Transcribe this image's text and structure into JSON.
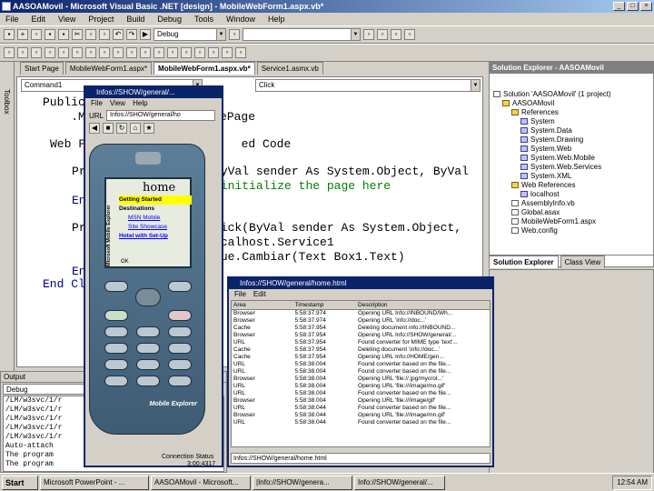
{
  "window": {
    "title": "AASOAMovil - Microsoft Visual Basic .NET [design] - MobileWebForm1.aspx.vb*"
  },
  "menu": [
    "File",
    "Edit",
    "View",
    "Project",
    "Build",
    "Debug",
    "Tools",
    "Window",
    "Help"
  ],
  "toolbar": {
    "config": "Debug"
  },
  "code_toolbar": {
    "object": "Command1",
    "event": "Click"
  },
  "tabs": [
    "Start Page",
    "MobileWebForm1.aspx*",
    "MobileWebForm1.aspx.vb*",
    "Service1.asmx.vb"
  ],
  "left_toolbox_label": "Toolbox",
  "code_lines": [
    {
      "text": "Public",
      "cls": "kw"
    },
    {
      "text": "    .MobileControls.MobilePage",
      "cls": ""
    },
    {
      "text": "Web F                      ed Code",
      "cls": ""
    },
    {
      "text": "Pri                 ByVal sender As System.Object, ByVal",
      "cls": ""
    },
    {
      "text": "                     initialize the page here",
      "cls": "cm"
    },
    {
      "text": "End",
      "cls": "kw"
    },
    {
      "text": "Pri                 lick(ByVal sender As System.Object,",
      "cls": ""
    },
    {
      "text": "                   localhost.Service1",
      "cls": ""
    },
    {
      "text": "                   gmue.Cambiar(Text Box1.Text)",
      "cls": ""
    },
    {
      "text": "End",
      "cls": "kw"
    },
    {
      "text": "End Cl",
      "cls": "kw"
    }
  ],
  "output": {
    "title": "Output",
    "mode": "Debug",
    "lines": [
      "/LM/w3svc/1/r",
      "/LM/w3svc/1/r",
      "/LM/w3svc/1/r",
      "/LM/w3svc/1/r",
      "/LM/w3svc/1/r",
      "Auto-attach",
      "The program",
      "The program"
    ]
  },
  "solution_explorer": {
    "title": "Solution Explorer - AASOAMovil",
    "items": [
      {
        "label": "Solution 'AASOAMovil' (1 project)",
        "icon": "file",
        "indent": 0
      },
      {
        "label": "AASOAMovil",
        "icon": "folder",
        "indent": 1
      },
      {
        "label": "References",
        "icon": "folder",
        "indent": 2
      },
      {
        "label": "System",
        "icon": "ref",
        "indent": 3
      },
      {
        "label": "System.Data",
        "icon": "ref",
        "indent": 3
      },
      {
        "label": "System.Drawing",
        "icon": "ref",
        "indent": 3
      },
      {
        "label": "System.Web",
        "icon": "ref",
        "indent": 3
      },
      {
        "label": "System.Web.Mobile",
        "icon": "ref",
        "indent": 3
      },
      {
        "label": "System.Web.Services",
        "icon": "ref",
        "indent": 3
      },
      {
        "label": "System.XML",
        "icon": "ref",
        "indent": 3
      },
      {
        "label": "Web References",
        "icon": "folder",
        "indent": 2
      },
      {
        "label": "localhost",
        "icon": "ref",
        "indent": 3
      },
      {
        "label": "AssemblyInfo.vb",
        "icon": "file",
        "indent": 2
      },
      {
        "label": "Global.asax",
        "icon": "file",
        "indent": 2
      },
      {
        "label": "MobileWebForm1.aspx",
        "icon": "file",
        "indent": 2
      },
      {
        "label": "Web.config",
        "icon": "file",
        "indent": 2
      }
    ],
    "tabs": [
      "Solution Explorer",
      "Class View"
    ]
  },
  "emulator": {
    "title": "Infos://SHOW/general/...",
    "menu": [
      "File",
      "View",
      "Help"
    ],
    "url_label": "URL",
    "url": "Infos://SHOW/general/ho",
    "screen_title": "home",
    "side_label": "Microsoft Mobile Explorer",
    "links": [
      "Getting Started",
      "Destinations",
      "MSN Mobile",
      "Site Showcase",
      "Hotel with Set-Up"
    ],
    "softkey": "OK",
    "brand": "Mobile Explorer",
    "footer": "Connection Status",
    "footer2": "3:00:4317"
  },
  "log_window": {
    "title": "Infos://SHOW/general/home.html",
    "menu": [
      "File",
      "Edit"
    ],
    "headers": [
      "Area",
      "Timestamp",
      "Description"
    ],
    "rows": [
      [
        "Browser",
        "5:58:37.974",
        "Opening URL Info://INBOUND/Wh..."
      ],
      [
        "Browser",
        "5:58:37.974",
        "Opening URL 'info://doc...'"
      ],
      [
        "Cache",
        "5:58:37.954",
        "Deleting document info://INBOUND..."
      ],
      [
        "Browser",
        "5:58:37.954",
        "Opening URL Info://SHOW/general/..."
      ],
      [
        "URL",
        "5:58:37.954",
        "Found converter for MIME type 'text'..."
      ],
      [
        "Cache",
        "5:58:37.954",
        "Deleting document 'info://doc...'"
      ],
      [
        "Cache",
        "5:58:37.954",
        "Opening URL Info://HOME/gen..."
      ],
      [
        "URL",
        "5:58:38.004",
        "Found converter based on the file..."
      ],
      [
        "URL",
        "5:58:38.004",
        "Found converter based on the file..."
      ],
      [
        "Browser",
        "5:58:38.004",
        "Opening URL 'file://.jpg/mycrol...'"
      ],
      [
        "URL",
        "5:58:38.004",
        "Opening URL 'file:///image/mo.gif'"
      ],
      [
        "URL",
        "5:58:38.004",
        "Found converter based on the file..."
      ],
      [
        "Browser",
        "5:58:38.004",
        "Opening URL 'file:///image/gif'"
      ],
      [
        "URL",
        "5:58:38.044",
        "Found converter based on the file..."
      ],
      [
        "Browser",
        "5:58:38.044",
        "Opening URL 'file:///image/mn.gif'"
      ],
      [
        "URL",
        "5:58:38.044",
        "Found converter based on the file..."
      ]
    ],
    "status": "Infos://SHOW/general/home.html"
  },
  "taskbar": {
    "start": "Start",
    "tasks": [
      "Microsoft PowerPoint - ...",
      "AASOAMovil - Microsoft...",
      "|Info://SHOW/genera...",
      "Info://SHOW/general/..."
    ],
    "clock": "12:54 AM"
  }
}
